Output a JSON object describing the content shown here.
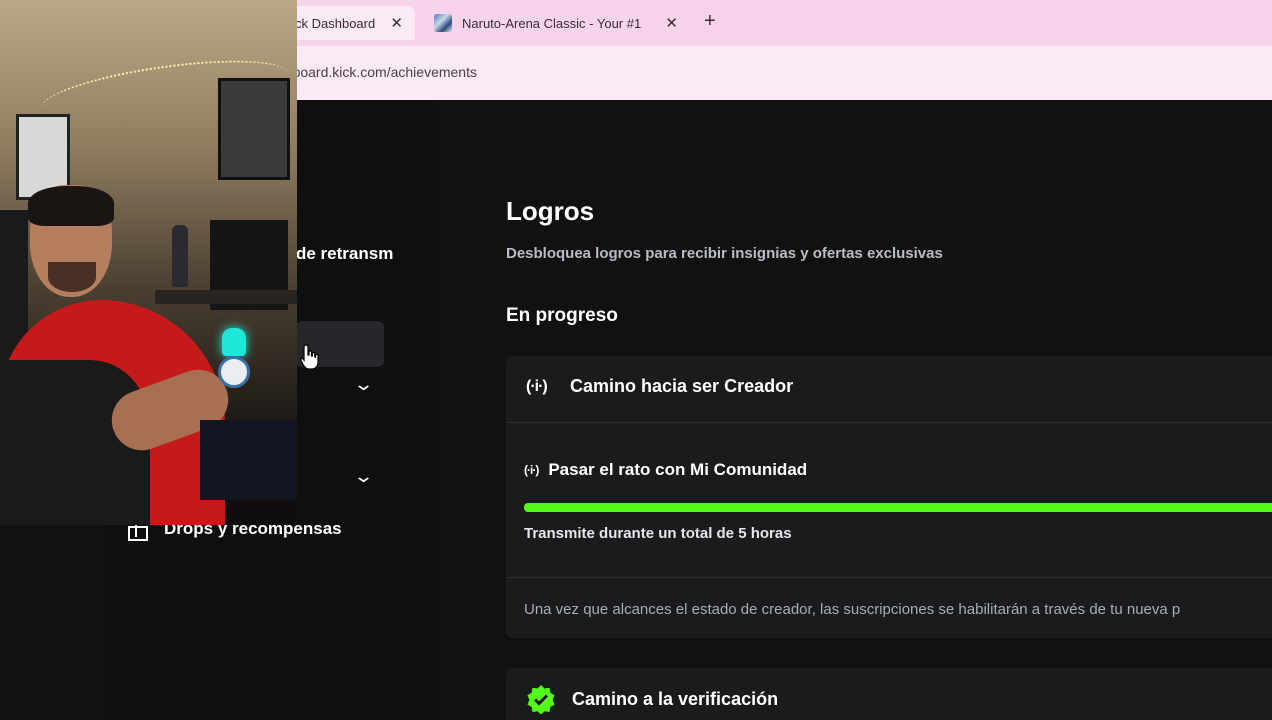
{
  "browser": {
    "tabs": [
      {
        "title": "ck Dashboard",
        "active": true
      },
      {
        "title": "Naruto-Arena Classic - Your #1",
        "active": false
      }
    ],
    "close_glyph": "✕",
    "new_tab_glyph": "+",
    "url": "ashboard.kick.com/achievements"
  },
  "sidebar": {
    "section_label": "de retransm",
    "chevron_glyph": "⌄",
    "drops_label": "Drops y recompensas",
    "drops_icon": "gift-icon"
  },
  "main": {
    "title": "Logros",
    "subtitle": "Desbloquea logros para recibir insignias y ofertas exclusivas",
    "in_progress_heading": "En progreso",
    "creator_path": {
      "icon_glyph": "(·i·)",
      "title": "Camino hacia ser Creador",
      "task": {
        "icon_glyph": "(·i·)",
        "title": "Pasar el rato con Mi Comunidad",
        "progress": 1.0,
        "requirement": "Transmite durante un total de 5 horas"
      },
      "note": "Una vez que alcances el estado de creador, las suscripciones se habilitarán a través de tu nueva p"
    },
    "verification_path": {
      "icon": "verified-badge-icon",
      "title": "Camino a la verificación"
    }
  },
  "colors": {
    "accent_green": "#53fc18",
    "page_bg": "#111112",
    "card_bg": "#1a1b1d",
    "tab_bar": "#f7d4ec"
  }
}
